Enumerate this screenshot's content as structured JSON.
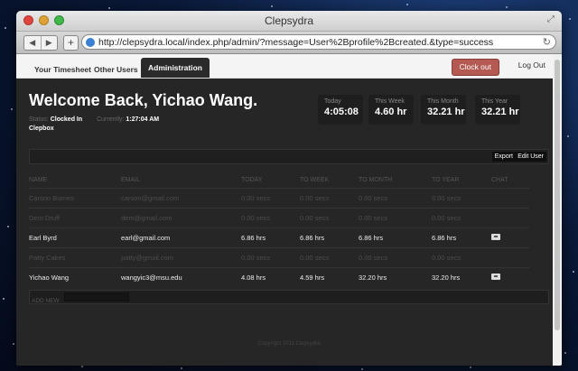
{
  "window": {
    "title": "Clepsydra"
  },
  "browser": {
    "url": "http://clepsydra.local/index.php/admin/?message=User%2Bprofile%2Bcreated.&type=success",
    "back": "◀",
    "forward": "▶",
    "new_tab": "+",
    "reload": "↻"
  },
  "nav": {
    "tabs": [
      "Your Timesheet",
      "Other Users",
      "Administration"
    ],
    "clock_out": "Clock out",
    "log_out": "Log Out"
  },
  "header": {
    "welcome": "Welcome Back, Yichao Wang.",
    "status_label": "Status:",
    "status_value": "Clocked In",
    "currently_label": "Currently:",
    "currently_value": "1:27:04 AM",
    "company": "Clepbox"
  },
  "stats": [
    {
      "label": "Today",
      "value": "4:05:08"
    },
    {
      "label": "This Week",
      "value": "4.60 hr"
    },
    {
      "label": "This Month",
      "value": "32.21 hr"
    },
    {
      "label": "This Year",
      "value": "32.21 hr"
    }
  ],
  "actions": {
    "export": "Export",
    "edit_user": "Edit User"
  },
  "table": {
    "headers": [
      "NAME",
      "EMAIL",
      "TODAY",
      "TO WEEK",
      "TO MONTH",
      "TO YEAR",
      "CHAT"
    ],
    "rows": [
      {
        "name": "Carson Burnes",
        "email": "carson@gmail.com",
        "today": "0.00 secs",
        "week": "0.00 secs",
        "month": "0.00 secs",
        "year": "0.00 secs"
      },
      {
        "name": "Dem Druff",
        "email": "dem@gmail.com",
        "today": "0.00 secs",
        "week": "0.00 secs",
        "month": "0.00 secs",
        "year": "0.00 secs"
      },
      {
        "name": "Earl Byrd",
        "email": "earl@gmail.com",
        "today": "6.86 hrs",
        "week": "6.86 hrs",
        "month": "6.86 hrs",
        "year": "6.86 hrs"
      },
      {
        "name": "Patty Cakes",
        "email": "patty@gmail.com",
        "today": "0.00 secs",
        "week": "0.00 secs",
        "month": "0.00 secs",
        "year": "0.00 secs"
      },
      {
        "name": "Yichao Wang",
        "email": "wangyic3@msu.edu",
        "today": "4.08 hrs",
        "week": "4.59 hrs",
        "month": "32.20 hrs",
        "year": "32.20 hrs"
      }
    ]
  },
  "add_new": {
    "label": "ADD NEW"
  },
  "footer": {
    "text": "Copyright 2011 Clepsydra"
  }
}
